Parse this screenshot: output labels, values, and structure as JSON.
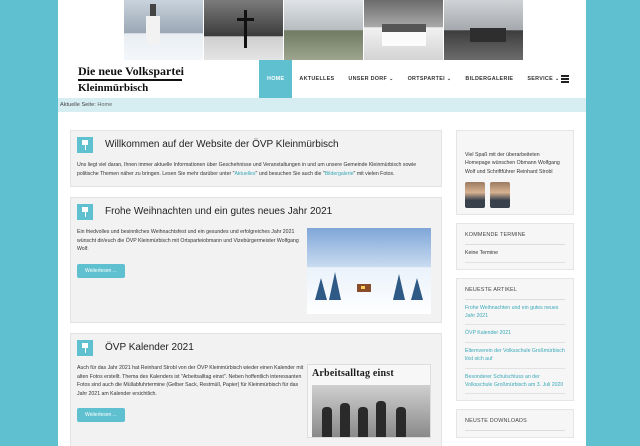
{
  "header": {
    "photos": [
      "church-photo",
      "cross-photo",
      "playground-photo",
      "house-photo",
      "castle-photo"
    ],
    "logo_line1": "Die neue Volkspartei",
    "logo_line2": "Kleinmürbisch"
  },
  "nav": {
    "items": [
      {
        "label": "HOME",
        "active": true,
        "dropdown": false
      },
      {
        "label": "AKTUELLES",
        "active": false,
        "dropdown": false
      },
      {
        "label": "UNSER DORF",
        "active": false,
        "dropdown": true
      },
      {
        "label": "ORTSPARTEI",
        "active": false,
        "dropdown": true
      },
      {
        "label": "BILDERGALERIE",
        "active": false,
        "dropdown": false
      },
      {
        "label": "SERVICE",
        "active": false,
        "dropdown": true
      }
    ],
    "caret": "⌄"
  },
  "breadcrumb": {
    "prefix": "Aktuelle Seite:",
    "current": "Home"
  },
  "posts": [
    {
      "title": "Willkommen auf der Website der ÖVP Kleinmürbisch",
      "text_a": "Uns liegt viel daran, Ihnen immer aktuelle Informationen über Geschehnisse und Veranstaltungen in und um unsere Gemeinde Kleinmürbisch sowie politische Themen näher zu bringen. Lesen Sie mehr darüber unter \"",
      "link1": "Aktuelles",
      "text_b": "\" und besuchen Sie auch die \"",
      "link2": "Bildergalerie",
      "text_c": "\" mit vielen Fotos."
    },
    {
      "title": "Frohe Weihnachten und ein gutes neues Jahr 2021",
      "text": "Ein friedvolles und besinnliches Weihnachtsfest und ein gesundes und erfolgreiches Jahr 2021 wünscht dir/euch die ÖVP Kleinmürbisch mit Ortsparteiobmann und Vizebürgermeister Wolfgang Wolf.",
      "button": "Weiterlesen ..."
    },
    {
      "title": "ÖVP Kalender 2021",
      "text": "Auch für das Jahr 2021 hat Reinhard Strobl von der ÖVP Kleinmürbisch wieder einen Kalender mit alten Fotos erstellt. Thema des Kalenders ist \"Arbeitsalltag einst\". Neben hoffentlich interessanten Fotos sind auch die Müllabfuhrtermine (Gelber Sack, Restmüll, Papier) für Kleinmürbisch für das Jahr 2021 am Kalender ersichtlich.",
      "image_heading": "Arbeitsalltag einst",
      "button": "Weiterlesen ..."
    }
  ],
  "sidebar": {
    "welcome_text": "Viel Spaß mit der überarbeiteten Homepage wünschen Obmann Wolfgang Wolf und Schriftführer Reinhard Strobl",
    "termine_heading": "KOMMENDE TERMINE",
    "termine_empty": "Keine Termine",
    "articles_heading": "NEUESTE ARTIKEL",
    "articles": [
      "Frohe Weihnachten und ein gutes neues Jahr 2021",
      "ÖVP Kalender 2021",
      "Elternverein der Volksschule Großmürbisch löst sich auf",
      "Besonderer Schulschluss an der Volksschule Großmürbisch am 3. Juli 2020"
    ],
    "downloads_heading": "NEUSTE DOWNLOADS"
  },
  "colors": {
    "accent": "#5fc1cf",
    "link": "#3aa8b8",
    "breadcrumb_bg": "#d6eef2"
  }
}
